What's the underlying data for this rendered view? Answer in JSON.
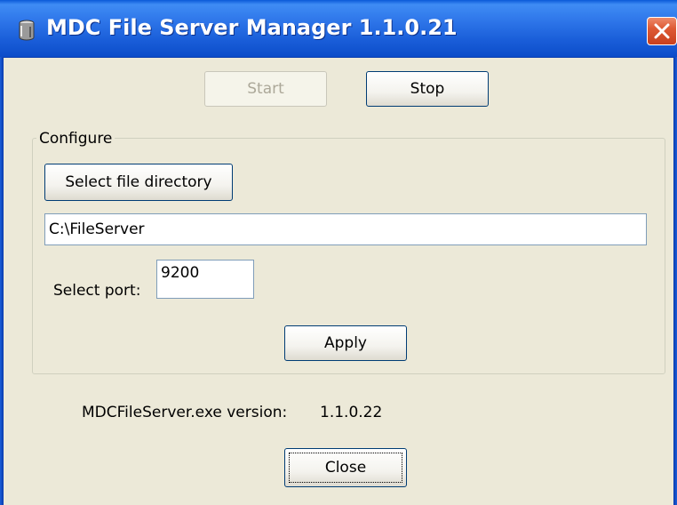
{
  "window": {
    "title": "MDC File Server Manager 1.1.0.21",
    "app_icon": "server-app-icon",
    "close_icon": "close-x-icon",
    "titlebar_color": "#1a5ed9",
    "close_color": "#de5a34"
  },
  "controls": {
    "start_label": "Start",
    "start_enabled": false,
    "stop_label": "Stop"
  },
  "configure": {
    "group_label": "Configure",
    "select_dir_label": "Select file directory",
    "directory_value": "C:\\FileServer",
    "port_label": "Select port:",
    "port_value": "9200",
    "apply_label": "Apply"
  },
  "info": {
    "exe_version_label": "MDCFileServer.exe version:",
    "exe_version_value": "1.1.0.22"
  },
  "footer": {
    "close_label": "Close"
  }
}
